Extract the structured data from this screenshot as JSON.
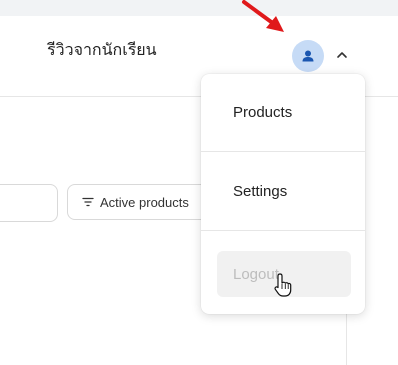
{
  "header": {
    "title": "รีวิวจากนักเรียน"
  },
  "user_menu": {
    "items": [
      {
        "label": "Products"
      },
      {
        "label": "Settings"
      }
    ],
    "logout_label": "Logout"
  },
  "toolbar": {
    "filter_label": "Active products"
  },
  "colors": {
    "accent": "#1a56b0",
    "avatar_bg": "#c6dbf6",
    "annotation_arrow": "#e0191b"
  },
  "icons": [
    "user-icon",
    "chevron-up-icon",
    "filter-icon",
    "hand-pointer-icon",
    "annotation-arrow-icon"
  ]
}
